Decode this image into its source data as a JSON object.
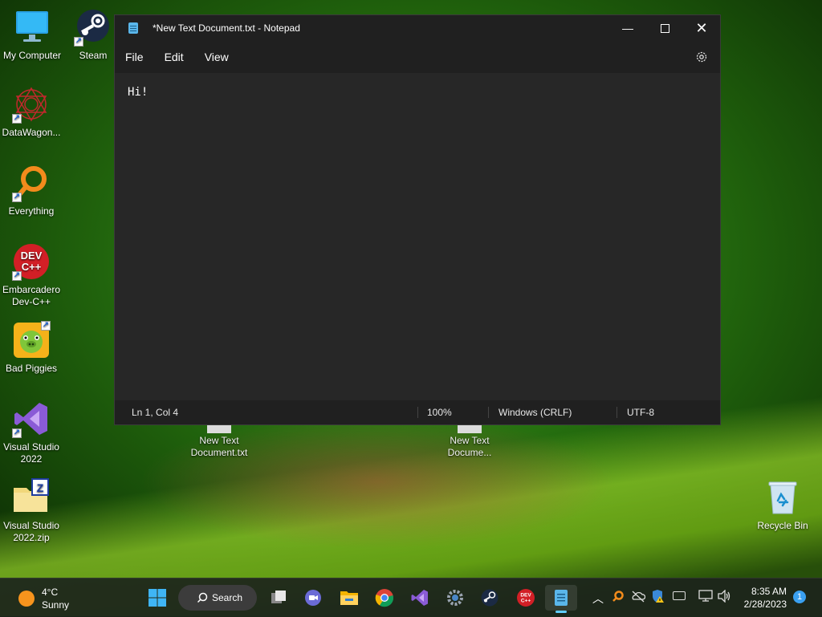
{
  "desktop": {
    "icons": [
      {
        "label": "My Computer"
      },
      {
        "label": "Steam"
      },
      {
        "label": "DataWagon..."
      },
      {
        "label": "Everything"
      },
      {
        "label": "Embarcadero Dev-C++"
      },
      {
        "label": "Bad Piggies"
      },
      {
        "label": "Visual Studio 2022"
      },
      {
        "label": "Visual Studio 2022.zip"
      },
      {
        "label": "Recycle Bin"
      }
    ],
    "files": [
      {
        "label": "New Text Document.txt"
      },
      {
        "label": "New Text Docume..."
      }
    ]
  },
  "notepad": {
    "title": "*New Text Document.txt - Notepad",
    "menu": [
      "File",
      "Edit",
      "View"
    ],
    "content": "Hi!",
    "status": {
      "position": "Ln 1, Col 4",
      "zoom": "100%",
      "line_ending": "Windows (CRLF)",
      "encoding": "UTF-8"
    }
  },
  "taskbar": {
    "weather": {
      "temp": "4°C",
      "condition": "Sunny"
    },
    "search_label": "Search",
    "pinned": [
      "task-view-icon",
      "teams-chat-icon",
      "file-explorer-icon",
      "chrome-icon",
      "visual-studio-icon",
      "settings-icon",
      "steam-icon",
      "devcpp-icon",
      "notepad-icon"
    ],
    "clock": {
      "time": "8:35 AM",
      "date": "2/28/2023"
    },
    "notification_count": "1"
  }
}
